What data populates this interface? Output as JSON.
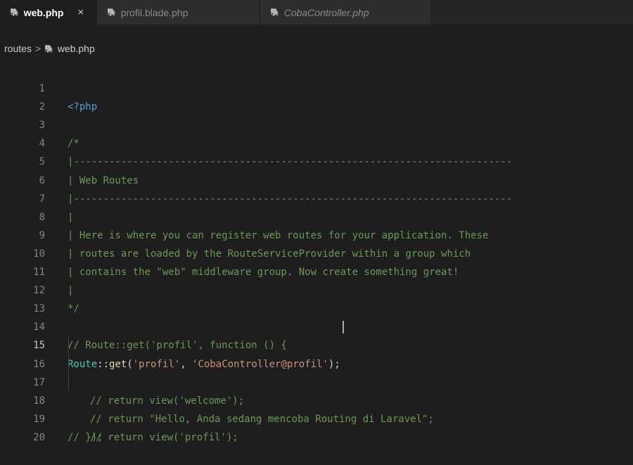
{
  "tabs": [
    {
      "label": "web.php",
      "icon": "php-elephant-icon",
      "active": true,
      "close": "×"
    },
    {
      "label": "profil.blade.php",
      "icon": "php-elephant-icon",
      "active": false
    },
    {
      "label": "CobaController.php",
      "icon": "php-elephant-icon",
      "active": false
    }
  ],
  "breadcrumb": {
    "folder": "routes",
    "separator": ">",
    "file": "web.php"
  },
  "line_numbers": [
    "1",
    "2",
    "3",
    "4",
    "5",
    "6",
    "7",
    "8",
    "9",
    "10",
    "11",
    "12",
    "13",
    "14",
    "15",
    "16",
    "17",
    "18",
    "19",
    "20"
  ],
  "code": {
    "l1": "<?php",
    "l3": "/*",
    "l4": "|--------------------------------------------------------------------------",
    "l5": "| Web Routes",
    "l6": "|--------------------------------------------------------------------------",
    "l7": "|",
    "l8": "| Here is where you can register web routes for your application. These",
    "l9": "| routes are loaded by the RouteServiceProvider within a group which",
    "l10": "| contains the \"web\" middleware group. Now create something great!",
    "l11": "|",
    "l12": "*/",
    "l14": "// Route::get('profil', function () {",
    "l15_class": "Route",
    "l15_op": "::",
    "l15_fn": "get",
    "l15_open": "(",
    "l15_arg1": "'profil'",
    "l15_comma": ", ",
    "l15_arg2": "'CobaController@profil'",
    "l15_close": ");",
    "l16": "// return view('welcome');",
    "l17": "// return \"Hello, Anda sedang mencoba Routing di Laravel\";",
    "l18": "// return view('profil');",
    "l19": "// });"
  },
  "colors": {
    "background": "#1e1e1e",
    "comment": "#6a9955",
    "string": "#ce9178",
    "keyword": "#569cd6",
    "class": "#4ec9b0",
    "function": "#dcdcaa"
  }
}
